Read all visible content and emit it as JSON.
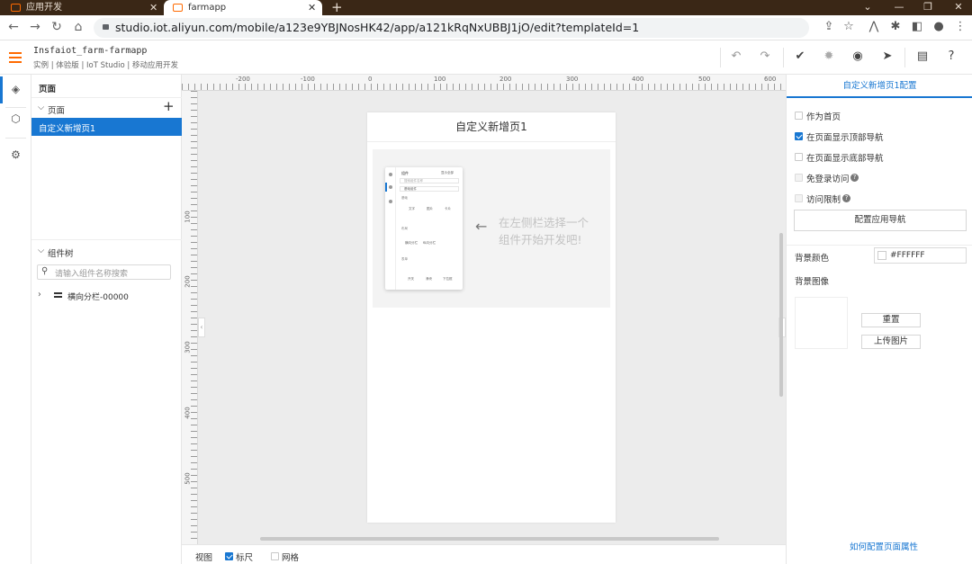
{
  "browser": {
    "tabs": [
      {
        "title": "应用开发",
        "active": false
      },
      {
        "title": "farmapp",
        "active": true
      }
    ],
    "new_tab": "+",
    "url": "studio.iot.aliyun.com/mobile/a123e9YBJNosHK42/app/a121kRqNxUBBJ1jO/edit?templateId=1"
  },
  "app": {
    "project_name": "Insfaiot_farm-farmapp",
    "breadcrumb": "实例 | 体验版 | IoT Studio | 移动应用开发"
  },
  "left_panel": {
    "pages_title": "页面",
    "pages_group": "页面",
    "add": "+",
    "pages": [
      "自定义新增页1"
    ],
    "tree_title": "组件树",
    "search_placeholder": "请输入组件名称搜索",
    "tree_items": [
      "横向分栏-00000"
    ]
  },
  "canvas": {
    "ruler_top": [
      "-200",
      "-100",
      "0",
      "100",
      "200",
      "300",
      "400",
      "500",
      "600"
    ],
    "ruler_left": [
      "100",
      "200",
      "300",
      "400",
      "500"
    ],
    "phone_title": "自定义新增页1",
    "hint_line1": "在左侧栏选择一个",
    "hint_line2": "组件开始开发吧!",
    "mini": {
      "header": "组件",
      "toggle": "显示全部",
      "search": "搜索组件名称",
      "select": "基础组件",
      "sec1": "基础",
      "items1": [
        "文字",
        "图片",
        "卡片"
      ],
      "sec2": "布局",
      "items2": [
        "横向分栏",
        "纵向分栏"
      ],
      "sec3": "表单",
      "items3": [
        "开关",
        "滑块",
        "下拉框"
      ]
    }
  },
  "footer": {
    "view_label": "视图",
    "ruler_label": "标尺",
    "ruler_checked": true,
    "grid_label": "网格",
    "grid_checked": false
  },
  "right_panel": {
    "tab_title": "自定义新增页1配置",
    "options": [
      {
        "label": "作为首页",
        "checked": false,
        "disabled": false,
        "help": false
      },
      {
        "label": "在页面显示顶部导航",
        "checked": true,
        "disabled": false,
        "help": false
      },
      {
        "label": "在页面显示底部导航",
        "checked": false,
        "disabled": false,
        "help": false
      },
      {
        "label": "免登录访问",
        "checked": false,
        "disabled": true,
        "help": true
      },
      {
        "label": "访问限制",
        "checked": false,
        "disabled": true,
        "help": true
      }
    ],
    "nav_button": "配置应用导航",
    "bg_color_label": "背景颜色",
    "bg_color_value": "#FFFFFF",
    "bg_image_label": "背景图像",
    "reset_button": "重置",
    "upload_button": "上传图片",
    "help_link": "如何配置页面属性"
  },
  "colors": {
    "accent": "#1877d2",
    "brand": "#ff6a00",
    "chrome": "#3a2716"
  }
}
